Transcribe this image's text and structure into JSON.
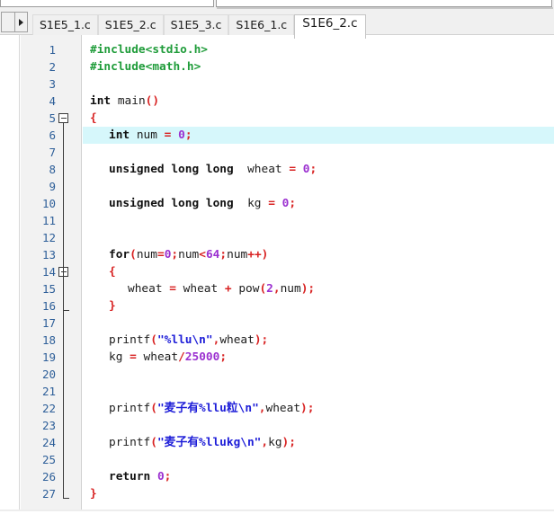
{
  "tabbar": {
    "scroll_left_label": "",
    "scroll_right_label": "▸",
    "tabs": [
      {
        "label": "S1E5_1.c",
        "active": false
      },
      {
        "label": "S1E5_2.c",
        "active": false
      },
      {
        "label": "S1E5_3.c",
        "active": false
      },
      {
        "label": "S1E6_1.c",
        "active": false
      },
      {
        "label": "S1E6_2.c",
        "active": true
      }
    ]
  },
  "editor": {
    "active_file": "S1E6_2.c",
    "highlighted_line": 6,
    "fold_markers": [
      {
        "line": 5,
        "type": "open"
      },
      {
        "line": 14,
        "type": "open"
      },
      {
        "line": 16,
        "type": "end"
      },
      {
        "line": 27,
        "type": "end"
      }
    ],
    "lines": [
      {
        "n": 1,
        "indent": 0,
        "tokens": [
          {
            "t": "#include<stdio.h>",
            "c": "t-pre"
          }
        ]
      },
      {
        "n": 2,
        "indent": 0,
        "tokens": [
          {
            "t": "#include<math.h>",
            "c": "t-pre"
          }
        ]
      },
      {
        "n": 3,
        "indent": 0,
        "tokens": []
      },
      {
        "n": 4,
        "indent": 0,
        "tokens": [
          {
            "t": "int",
            "c": "t-kw"
          },
          {
            "t": " main",
            "c": "t-id"
          },
          {
            "t": "()",
            "c": "t-op"
          }
        ]
      },
      {
        "n": 5,
        "indent": 0,
        "tokens": [
          {
            "t": "{",
            "c": "t-brace"
          }
        ]
      },
      {
        "n": 6,
        "indent": 1,
        "tokens": [
          {
            "t": "int",
            "c": "t-kw"
          },
          {
            "t": " num ",
            "c": "t-id"
          },
          {
            "t": "=",
            "c": "t-op"
          },
          {
            "t": " ",
            "c": "t-id"
          },
          {
            "t": "0",
            "c": "t-num"
          },
          {
            "t": ";",
            "c": "t-op"
          }
        ]
      },
      {
        "n": 7,
        "indent": 0,
        "tokens": []
      },
      {
        "n": 8,
        "indent": 1,
        "tokens": [
          {
            "t": "unsigned long long",
            "c": "t-kw"
          },
          {
            "t": "  wheat ",
            "c": "t-id"
          },
          {
            "t": "=",
            "c": "t-op"
          },
          {
            "t": " ",
            "c": "t-id"
          },
          {
            "t": "0",
            "c": "t-num"
          },
          {
            "t": ";",
            "c": "t-op"
          }
        ]
      },
      {
        "n": 9,
        "indent": 0,
        "tokens": []
      },
      {
        "n": 10,
        "indent": 1,
        "tokens": [
          {
            "t": "unsigned long long",
            "c": "t-kw"
          },
          {
            "t": "  kg ",
            "c": "t-id"
          },
          {
            "t": "=",
            "c": "t-op"
          },
          {
            "t": " ",
            "c": "t-id"
          },
          {
            "t": "0",
            "c": "t-num"
          },
          {
            "t": ";",
            "c": "t-op"
          }
        ]
      },
      {
        "n": 11,
        "indent": 0,
        "tokens": []
      },
      {
        "n": 12,
        "indent": 0,
        "tokens": []
      },
      {
        "n": 13,
        "indent": 1,
        "tokens": [
          {
            "t": "for",
            "c": "t-kw"
          },
          {
            "t": "(",
            "c": "t-op"
          },
          {
            "t": "num",
            "c": "t-id"
          },
          {
            "t": "=",
            "c": "t-op"
          },
          {
            "t": "0",
            "c": "t-num"
          },
          {
            "t": ";",
            "c": "t-op"
          },
          {
            "t": "num",
            "c": "t-id"
          },
          {
            "t": "<",
            "c": "t-op"
          },
          {
            "t": "64",
            "c": "t-num"
          },
          {
            "t": ";",
            "c": "t-op"
          },
          {
            "t": "num",
            "c": "t-id"
          },
          {
            "t": "++)",
            "c": "t-op"
          }
        ]
      },
      {
        "n": 14,
        "indent": 1,
        "tokens": [
          {
            "t": "{",
            "c": "t-brace"
          }
        ]
      },
      {
        "n": 15,
        "indent": 2,
        "tokens": [
          {
            "t": "wheat ",
            "c": "t-id"
          },
          {
            "t": "=",
            "c": "t-op"
          },
          {
            "t": " wheat ",
            "c": "t-id"
          },
          {
            "t": "+",
            "c": "t-op"
          },
          {
            "t": " pow",
            "c": "t-id"
          },
          {
            "t": "(",
            "c": "t-op"
          },
          {
            "t": "2",
            "c": "t-num"
          },
          {
            "t": ",",
            "c": "t-op"
          },
          {
            "t": "num",
            "c": "t-id"
          },
          {
            "t": ");",
            "c": "t-op"
          }
        ]
      },
      {
        "n": 16,
        "indent": 1,
        "tokens": [
          {
            "t": "}",
            "c": "t-brace"
          }
        ]
      },
      {
        "n": 17,
        "indent": 0,
        "tokens": []
      },
      {
        "n": 18,
        "indent": 1,
        "tokens": [
          {
            "t": "printf",
            "c": "t-id"
          },
          {
            "t": "(",
            "c": "t-op"
          },
          {
            "t": "\"%llu\\n\"",
            "c": "t-str"
          },
          {
            "t": ",",
            "c": "t-op"
          },
          {
            "t": "wheat",
            "c": "t-id"
          },
          {
            "t": ");",
            "c": "t-op"
          }
        ]
      },
      {
        "n": 19,
        "indent": 1,
        "tokens": [
          {
            "t": "kg ",
            "c": "t-id"
          },
          {
            "t": "=",
            "c": "t-op"
          },
          {
            "t": " wheat",
            "c": "t-id"
          },
          {
            "t": "/",
            "c": "t-op"
          },
          {
            "t": "25000",
            "c": "t-num"
          },
          {
            "t": ";",
            "c": "t-op"
          }
        ]
      },
      {
        "n": 20,
        "indent": 0,
        "tokens": []
      },
      {
        "n": 21,
        "indent": 0,
        "tokens": []
      },
      {
        "n": 22,
        "indent": 1,
        "tokens": [
          {
            "t": "printf",
            "c": "t-id"
          },
          {
            "t": "(",
            "c": "t-op"
          },
          {
            "t": "\"麦子有%llu粒\\n\"",
            "c": "t-str"
          },
          {
            "t": ",",
            "c": "t-op"
          },
          {
            "t": "wheat",
            "c": "t-id"
          },
          {
            "t": ");",
            "c": "t-op"
          }
        ]
      },
      {
        "n": 23,
        "indent": 0,
        "tokens": []
      },
      {
        "n": 24,
        "indent": 1,
        "tokens": [
          {
            "t": "printf",
            "c": "t-id"
          },
          {
            "t": "(",
            "c": "t-op"
          },
          {
            "t": "\"麦子有%llukg\\n\"",
            "c": "t-str"
          },
          {
            "t": ",",
            "c": "t-op"
          },
          {
            "t": "kg",
            "c": "t-id"
          },
          {
            "t": ");",
            "c": "t-op"
          }
        ]
      },
      {
        "n": 25,
        "indent": 0,
        "tokens": []
      },
      {
        "n": 26,
        "indent": 1,
        "tokens": [
          {
            "t": "return",
            "c": "t-kw"
          },
          {
            "t": " ",
            "c": "t-id"
          },
          {
            "t": "0",
            "c": "t-num"
          },
          {
            "t": ";",
            "c": "t-op"
          }
        ]
      },
      {
        "n": 27,
        "indent": 0,
        "tokens": [
          {
            "t": "}",
            "c": "t-brace"
          }
        ]
      }
    ]
  },
  "colors": {
    "preprocessor": "#1f9c3a",
    "keyword": "#101010",
    "operator": "#d82222",
    "number": "#9b30d0",
    "string": "#1d1dd8",
    "line_number": "#2e5f99",
    "current_line_highlight": "#d6f7fb",
    "gutter_background": "#f2f2f2",
    "editor_background": "#ffffff"
  }
}
